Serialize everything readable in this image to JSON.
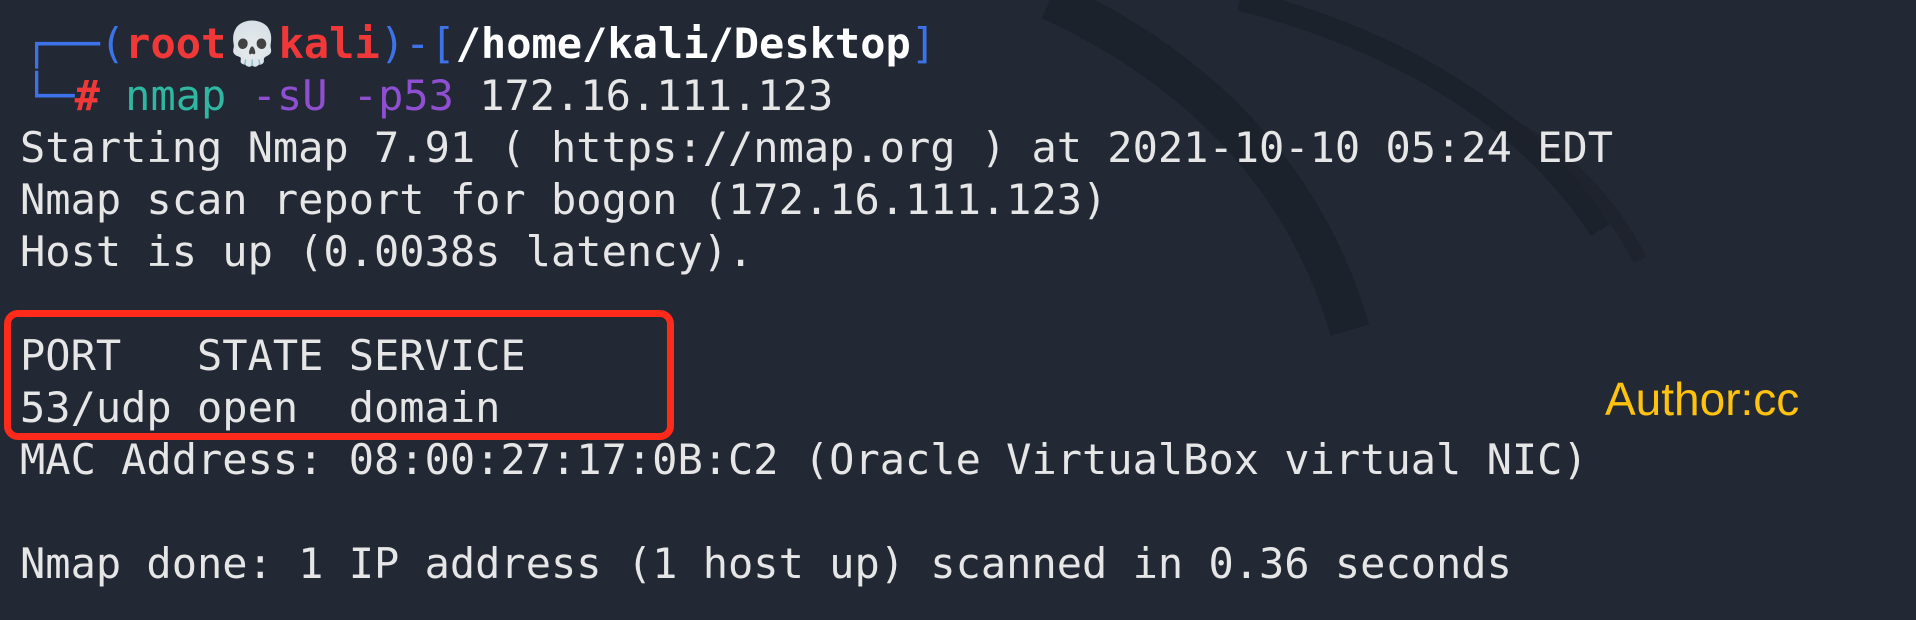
{
  "prompt": {
    "box_top": "┌──",
    "box_bottom": "└─",
    "open_paren": "(",
    "user": "root",
    "skull_icon": "💀",
    "host": "kali",
    "close_paren": ")-[",
    "path": "/home/kali/Desktop",
    "close_bracket": "]",
    "hash": "#",
    "command": "nmap",
    "flag_1": "-sU",
    "flag_2": "-p53",
    "target": "172.16.111.123"
  },
  "output": {
    "starting": "Starting Nmap 7.91 ( https://nmap.org ) at 2021-10-10 05:24 EDT",
    "report": "Nmap scan report for bogon (172.16.111.123)",
    "host_up": "Host is up (0.0038s latency).",
    "port_header": "PORT   STATE SERVICE",
    "port_row": "53/udp open  domain",
    "mac": "MAC Address: 08:00:27:17:0B:C2 (Oracle VirtualBox virtual NIC)",
    "done": "Nmap done: 1 IP address (1 host up) scanned in 0.36 seconds"
  },
  "watermark": "Author:cc",
  "colors": {
    "background": "#222834",
    "accent_blue": "#3d72e8",
    "user_red": "#f03838",
    "command_teal": "#2fb7a1",
    "flag_purple": "#8e4fd1",
    "highlight_red": "#ff2a1a",
    "watermark_yellow": "#ffc20e"
  }
}
